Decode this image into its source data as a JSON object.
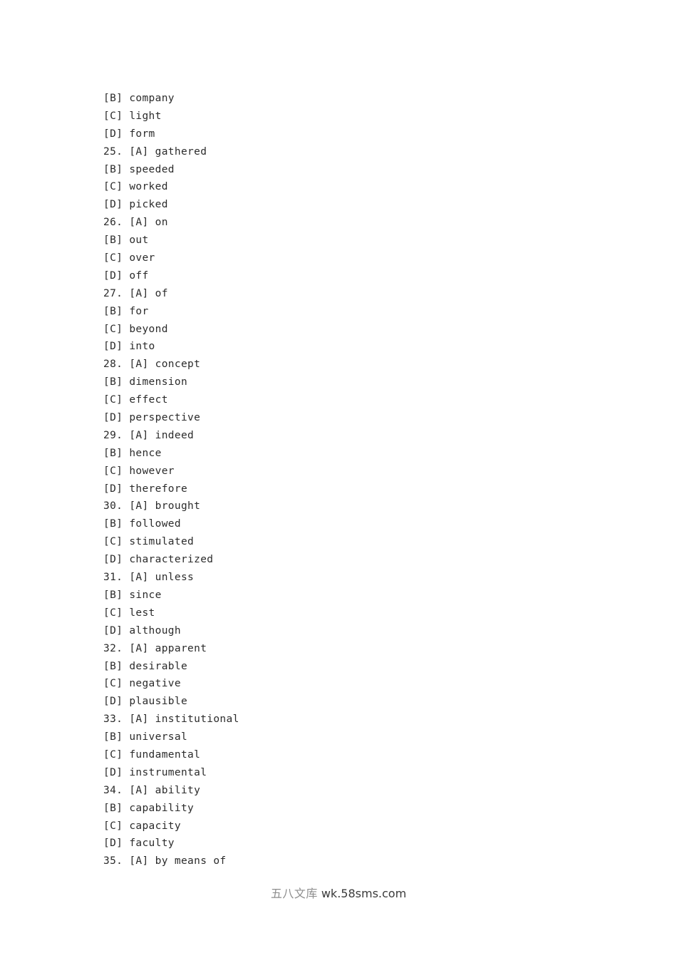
{
  "document": {
    "type": "exam-answer-options-page",
    "background_color": "#ffffff",
    "text_color": "#2b2b2b"
  },
  "options_list": {
    "lines": [
      {
        "text": "[B] company"
      },
      {
        "text": "[C] light"
      },
      {
        "text": "[D] form"
      },
      {
        "text": "25. [A] gathered"
      },
      {
        "text": "[B] speeded"
      },
      {
        "text": "[C] worked"
      },
      {
        "text": "[D] picked"
      },
      {
        "text": "26. [A] on"
      },
      {
        "text": "[B] out"
      },
      {
        "text": "[C] over"
      },
      {
        "text": "[D] off"
      },
      {
        "text": "27. [A] of"
      },
      {
        "text": "[B] for"
      },
      {
        "text": "[C] beyond"
      },
      {
        "text": "[D] into"
      },
      {
        "text": "28. [A] concept"
      },
      {
        "text": "[B] dimension"
      },
      {
        "text": "[C] effect"
      },
      {
        "text": "[D] perspective"
      },
      {
        "text": "29. [A] indeed"
      },
      {
        "text": "[B] hence"
      },
      {
        "text": "[C] however"
      },
      {
        "text": "[D] therefore"
      },
      {
        "text": "30. [A] brought"
      },
      {
        "text": "[B] followed"
      },
      {
        "text": "[C] stimulated"
      },
      {
        "text": "[D] characterized"
      },
      {
        "text": "31. [A] unless"
      },
      {
        "text": "[B] since"
      },
      {
        "text": "[C] lest"
      },
      {
        "text": "[D] although"
      },
      {
        "text": "32. [A] apparent"
      },
      {
        "text": "[B] desirable"
      },
      {
        "text": "[C] negative"
      },
      {
        "text": "[D] plausible"
      },
      {
        "text": "33. [A] institutional"
      },
      {
        "text": "[B] universal"
      },
      {
        "text": "[C] fundamental"
      },
      {
        "text": "[D] instrumental"
      },
      {
        "text": "34. [A] ability"
      },
      {
        "text": "[B] capability"
      },
      {
        "text": "[C] capacity"
      },
      {
        "text": "[D] faculty"
      },
      {
        "text": "35. [A] by means of"
      }
    ]
  },
  "watermark": {
    "cjk_text": "五八文库",
    "url_text": "wk.58sms.com",
    "cjk_color": "#8e8e8e",
    "url_color": "#3a3a3a"
  }
}
